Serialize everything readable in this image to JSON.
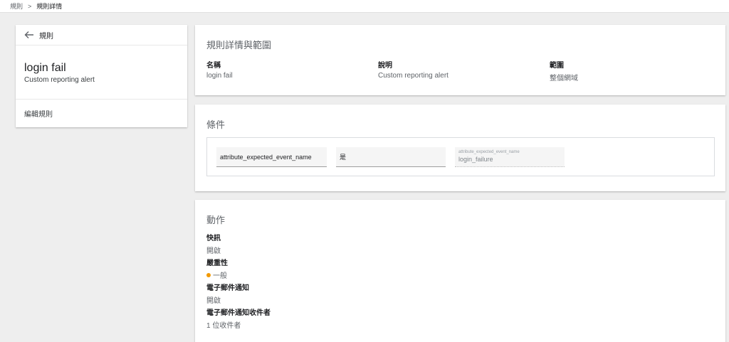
{
  "breadcrumb": {
    "root": "規則",
    "separator": ">",
    "current": "規則詳情"
  },
  "left_panel": {
    "back_label": "規則",
    "rule_name": "login fail",
    "rule_description": "Custom reporting alert",
    "edit_label": "編輯規則"
  },
  "scope": {
    "title": "規則詳情與範圍",
    "fields": [
      {
        "label": "名稱",
        "value": "login fail"
      },
      {
        "label": "說明",
        "value": "Custom reporting alert"
      },
      {
        "label": "範圍",
        "value": "整個網域"
      }
    ]
  },
  "conditions": {
    "title": "條件",
    "attribute": "attribute_expected_event_name",
    "operator": "是",
    "value_label": "attribute_expected_event_name",
    "value": "login_failure"
  },
  "actions": {
    "title": "動作",
    "items": [
      {
        "label": "快訊",
        "value": "開啟"
      },
      {
        "label": "嚴重性",
        "value": "一般"
      },
      {
        "label": "電子郵件通知",
        "value": "開啟"
      },
      {
        "label": "電子郵件通知收件者",
        "value": "1 位收件者"
      }
    ]
  },
  "colors": {
    "severity_dot": "#f29900",
    "page_background": "#eeeeee",
    "card_background": "#ffffff"
  },
  "icons": {
    "back": "arrow-left-icon",
    "breadcrumb_separator": "chevron-right-icon",
    "severity": "severity-dot-icon"
  }
}
